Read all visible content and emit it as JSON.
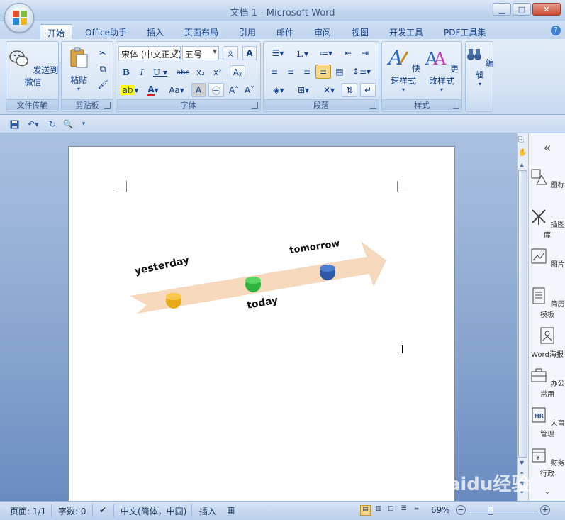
{
  "window": {
    "title": "文档 1 - Microsoft Word"
  },
  "tabs": [
    "开始",
    "Office助手",
    "插入",
    "页面布局",
    "引用",
    "邮件",
    "审阅",
    "视图",
    "开发工具",
    "PDF工具集"
  ],
  "ribbon": {
    "wechat": {
      "label": "发送到微信",
      "group": "文件传输"
    },
    "clipboard": {
      "paste": "粘贴",
      "group": "剪贴板"
    },
    "font": {
      "name": "宋体 (中文正文)",
      "size": "五号",
      "group": "字体",
      "wen": "wén\n文"
    },
    "paragraph": {
      "group": "段落"
    },
    "styles": {
      "quick": "快速样式",
      "change": "更改样式",
      "group": "样式"
    },
    "edit": {
      "label": "编辑"
    }
  },
  "document": {
    "arrow_labels": [
      "yesterday",
      "today",
      "tomorrow"
    ],
    "dot_colors": [
      "#e8a917",
      "#2fb33c",
      "#2d5aa8"
    ]
  },
  "sidebar": [
    "图标",
    "插图库",
    "图片",
    "简历模板",
    "Word海报",
    "办公常用",
    "人事管理",
    "财务行政"
  ],
  "status": {
    "page": "页面: 1/1",
    "words": "字数: 0",
    "language": "中文(简体，中国)",
    "mode": "插入",
    "zoom": "69%"
  },
  "watermark": "Baidu经验"
}
